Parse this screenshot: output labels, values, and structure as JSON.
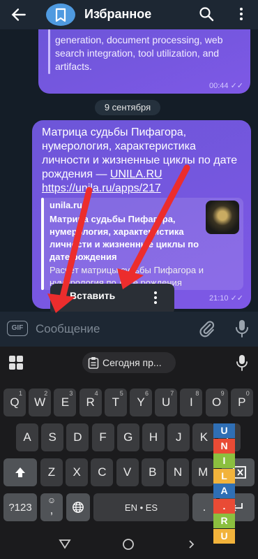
{
  "header": {
    "title": "Избранное",
    "icons": {
      "back": "arrow-left-icon",
      "avatar": "bookmark-icon",
      "search": "search-icon",
      "more": "more-vert-icon"
    }
  },
  "chat": {
    "prev_message": {
      "text": "generation, document processing, web search integration, tool utilization, and artifacts.",
      "time": "00:44",
      "status": "double-check"
    },
    "date_separator": "9 сентября",
    "message": {
      "text_line1": "Матрица судьбы Пифагора, нумерология, характеристика личности и жизненные циклы по дате рождения — ",
      "link_inline": "UNILA.RU",
      "url": "https://unila.ru/apps/217",
      "preview": {
        "site": "unila.ru",
        "title": "Матрица судьбы Пифагора, нумерология, характеристика личности и жизненные циклы по дате рождения",
        "description": "Расчёт матрицы судьбы Пифагора и нумерология по дате рождения"
      },
      "time": "21:10",
      "status": "double-check"
    }
  },
  "context_menu": {
    "paste": "Вставить",
    "more_icon": "more-vert-icon"
  },
  "input": {
    "gif_label": "GIF",
    "placeholder": "Сообщение",
    "value": "",
    "icons": {
      "attach": "paperclip-icon",
      "mic": "microphone-icon"
    }
  },
  "keyboard": {
    "clipboard_chip": "Сегодня пр...",
    "icons": {
      "apps": "grid-icon",
      "clip": "clipboard-icon",
      "voice": "microphone-icon",
      "shift": "shift-icon",
      "backspace": "backspace-icon",
      "emoji": "emoji-icon",
      "globe": "globe-icon",
      "enter": "enter-icon"
    },
    "row1": [
      {
        "k": "Q",
        "h": "1"
      },
      {
        "k": "W",
        "h": "2"
      },
      {
        "k": "E",
        "h": "3"
      },
      {
        "k": "R",
        "h": "4"
      },
      {
        "k": "T",
        "h": "5"
      },
      {
        "k": "Y",
        "h": "6"
      },
      {
        "k": "U",
        "h": "7"
      },
      {
        "k": "I",
        "h": "8"
      },
      {
        "k": "O",
        "h": "9"
      },
      {
        "k": "P",
        "h": "0"
      }
    ],
    "row2": [
      "A",
      "S",
      "D",
      "F",
      "G",
      "H",
      "J",
      "K",
      "L"
    ],
    "row3": [
      "Z",
      "X",
      "C",
      "V",
      "B",
      "N",
      "M"
    ],
    "symbols": "?123",
    "comma": ",",
    "space": "EN • ES",
    "period": "."
  },
  "navbar": {
    "icons": [
      "back-triangle-icon",
      "home-circle-icon",
      "recents-icon"
    ]
  },
  "watermark": {
    "letters": [
      "U",
      "N",
      "I",
      "L",
      "A",
      ".",
      "R",
      "U"
    ],
    "colors": [
      "#2f6fb5",
      "#e94b35",
      "#8bbf3f",
      "#f2b33b"
    ]
  }
}
